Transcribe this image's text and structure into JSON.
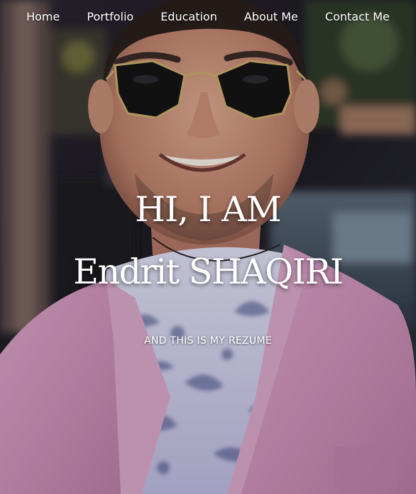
{
  "nav": {
    "items": [
      {
        "label": "Home"
      },
      {
        "label": "Portfolio"
      },
      {
        "label": "Education"
      },
      {
        "label": "About Me"
      },
      {
        "label": "Contact Me"
      }
    ]
  },
  "hero": {
    "line1": "HI, I AM",
    "line2": "Endrit SHAQIRI",
    "subtitle": "AND THIS IS MY REZUME"
  },
  "colors": {
    "text": "#ffffff",
    "jacket": "#c98fb6",
    "shirt": "#c7c6e6"
  }
}
